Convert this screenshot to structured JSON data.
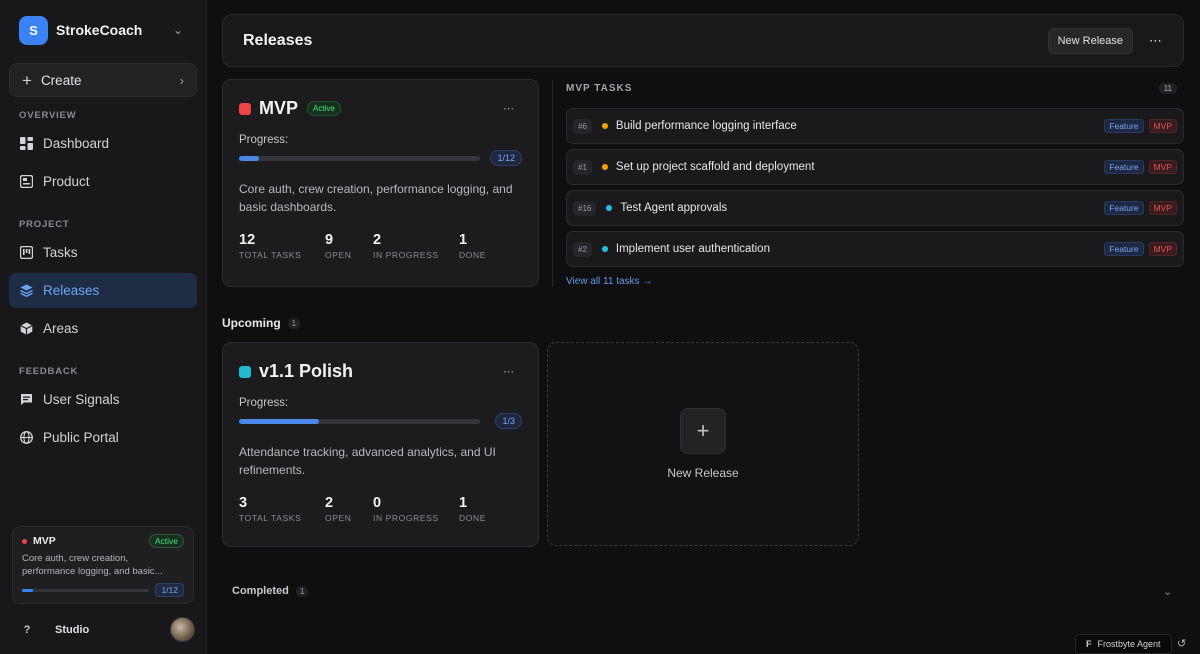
{
  "workspace": {
    "initial": "S",
    "name": "StrokeCoach"
  },
  "sidebar": {
    "create_label": "Create",
    "sections": {
      "overview": "OVERVIEW",
      "project": "PROJECT",
      "feedback": "FEEDBACK"
    },
    "items": [
      {
        "label": "Dashboard",
        "icon": "dashboard-icon"
      },
      {
        "label": "Product",
        "icon": "product-icon"
      },
      {
        "label": "Tasks",
        "icon": "tasks-icon"
      },
      {
        "label": "Releases",
        "icon": "releases-icon",
        "active": true
      },
      {
        "label": "Areas",
        "icon": "areas-icon"
      },
      {
        "label": "User Signals",
        "icon": "chat-icon"
      },
      {
        "label": "Public Portal",
        "icon": "globe-icon"
      }
    ],
    "current_release": {
      "name": "MVP",
      "status": "Active",
      "description": "Core auth, crew creation, performance logging, and basic...",
      "progress_text": "1/12",
      "progress_fraction": 0.083
    },
    "footer": {
      "help": "?",
      "studio": "Studio"
    }
  },
  "header": {
    "title": "Releases",
    "new_release": "New Release"
  },
  "mvp": {
    "name": "MVP",
    "status": "Active",
    "color": "#ef4444",
    "progress_label": "Progress:",
    "progress_text": "1/12",
    "progress_fraction": 0.083,
    "description": "Core auth, crew creation, performance logging, and basic dashboards.",
    "stats": [
      {
        "value": "12",
        "label": "TOTAL TASKS"
      },
      {
        "value": "9",
        "label": "OPEN"
      },
      {
        "value": "2",
        "label": "IN PROGRESS"
      },
      {
        "value": "1",
        "label": "DONE"
      }
    ]
  },
  "mvp_tasks": {
    "heading": "MVP TASKS",
    "count": "11",
    "view_all": "View all 11 tasks →",
    "rows": [
      {
        "id": "#6",
        "title": "Build performance logging interface",
        "status_color": "#f59e0b",
        "type": "Feature",
        "release": "MVP"
      },
      {
        "id": "#1",
        "title": "Set up project scaffold and deployment",
        "status_color": "#f59e0b",
        "type": "Feature",
        "release": "MVP"
      },
      {
        "id": "#16",
        "title": "Test Agent approvals",
        "status_color": "#22c1e6",
        "type": "Feature",
        "release": "MVP"
      },
      {
        "id": "#2",
        "title": "Implement user authentication",
        "status_color": "#22c1e6",
        "type": "Feature",
        "release": "MVP"
      }
    ]
  },
  "upcoming": {
    "title": "Upcoming",
    "count": "1",
    "release": {
      "name": "v1.1 Polish",
      "color": "#22b8cf",
      "progress_label": "Progress:",
      "progress_text": "1/3",
      "progress_fraction": 0.333,
      "description": "Attendance tracking, advanced analytics, and UI refinements.",
      "stats": [
        {
          "value": "3",
          "label": "TOTAL TASKS"
        },
        {
          "value": "2",
          "label": "OPEN"
        },
        {
          "value": "0",
          "label": "IN PROGRESS"
        },
        {
          "value": "1",
          "label": "DONE"
        }
      ]
    },
    "new_release_label": "New Release"
  },
  "completed": {
    "title": "Completed",
    "count": "1"
  },
  "agent": {
    "glyph": "F",
    "label": "Frostbyte Agent"
  },
  "colors": {
    "accent": "#3b82f6",
    "active_green": "#4ade80",
    "mvp_red": "#ef4444"
  }
}
